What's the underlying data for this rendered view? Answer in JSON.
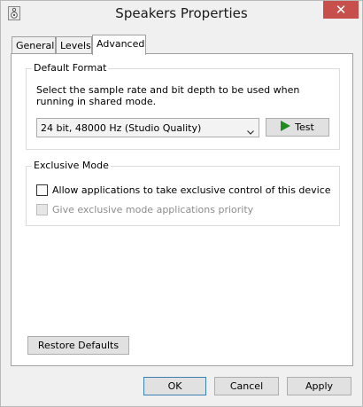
{
  "window": {
    "title": "Speakers Properties",
    "close_glyph": "✕"
  },
  "tabs": [
    {
      "label": "General"
    },
    {
      "label": "Levels"
    },
    {
      "label": "Advanced"
    }
  ],
  "default_format": {
    "legend": "Default Format",
    "description": "Select the sample rate and bit depth to be used when running in shared mode.",
    "selected_format": "24 bit, 48000 Hz (Studio Quality)",
    "test_label": "Test"
  },
  "exclusive_mode": {
    "legend": "Exclusive Mode",
    "allow_exclusive_label": "Allow applications to take exclusive control of this device",
    "allow_exclusive_checked": false,
    "priority_label": "Give exclusive mode applications priority",
    "priority_checked": false,
    "priority_enabled": false
  },
  "restore_label": "Restore Defaults",
  "dialog_buttons": {
    "ok": "OK",
    "cancel": "Cancel",
    "apply": "Apply"
  },
  "colors": {
    "close_button": "#c7504c",
    "play_icon": "#1f8a1f",
    "default_button_border": "#3c7fb1"
  },
  "icons": {
    "title": "speaker-icon",
    "test": "play-icon",
    "select": "chevron-down-icon"
  }
}
